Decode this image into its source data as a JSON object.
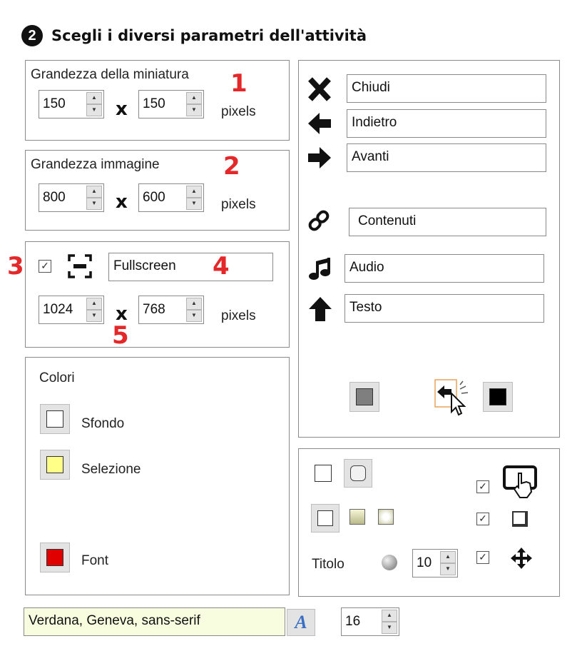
{
  "header": {
    "step": "2",
    "title": "Scegli i diversi parametri dell'attività"
  },
  "thumb": {
    "label": "Grandezza della miniatura",
    "width": "150",
    "height": "150",
    "sep": "x",
    "unit": "pixels",
    "marker": "1"
  },
  "image": {
    "label": "Grandezza immagine",
    "width": "800",
    "height": "600",
    "sep": "x",
    "unit": "pixels",
    "marker": "2"
  },
  "fullscreen": {
    "checked": "✓",
    "field": "Fullscreen",
    "width": "1024",
    "height": "768",
    "sep": "x",
    "unit": "pixels",
    "marker_check": "3",
    "marker_field": "4",
    "marker_size": "5"
  },
  "colors": {
    "title": "Colori",
    "items": [
      {
        "label": "Sfondo",
        "color": "#ffffff"
      },
      {
        "label": "Selezione",
        "color": "#ffff88"
      },
      {
        "label": "Font",
        "color": "#e00000"
      }
    ]
  },
  "buttons": {
    "close": "Chiudi",
    "back": "Indietro",
    "next": "Avanti",
    "contents": "Contenuti",
    "audio": "Audio",
    "text": "Testo",
    "color_gray": "#7f7f7f",
    "color_black": "#000000"
  },
  "options": {
    "title_label": "Titolo",
    "title_size": "10",
    "check": "✓"
  },
  "font": {
    "family": "Verdana, Geneva, sans-serif",
    "size": "16",
    "button_glyph": "A"
  }
}
